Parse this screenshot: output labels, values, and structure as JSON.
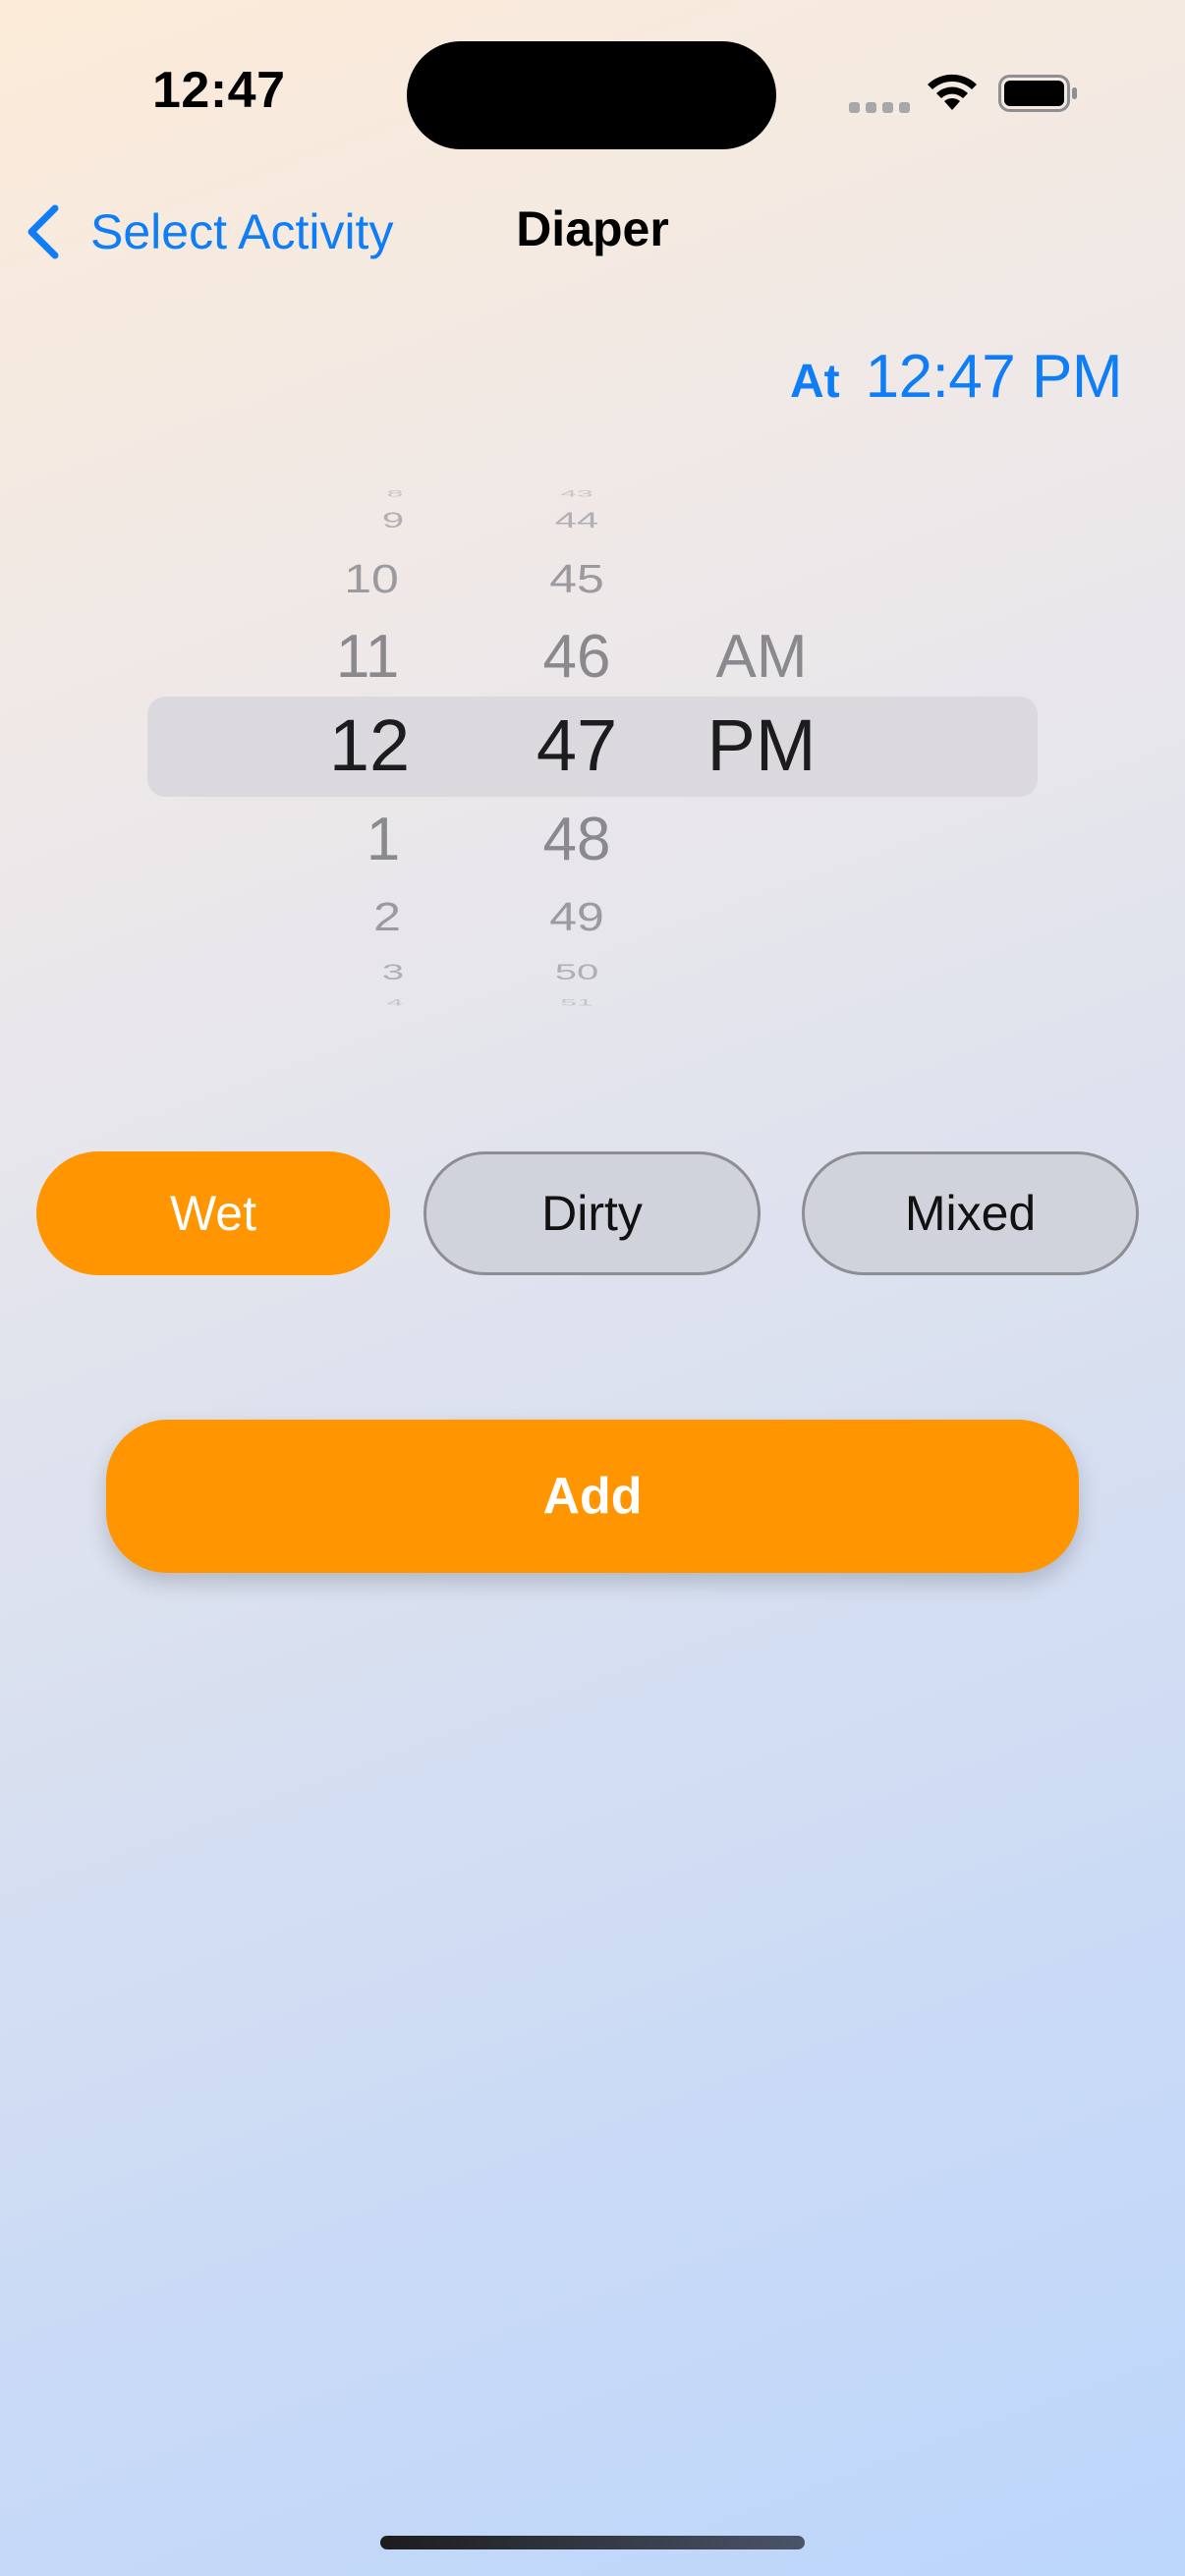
{
  "status_bar": {
    "time": "12:47"
  },
  "nav": {
    "back_label": "Select Activity",
    "title": "Diaper"
  },
  "time_display": {
    "at_label": "At",
    "value": "12:47 PM"
  },
  "picker": {
    "hours": {
      "above": [
        "8",
        "9",
        "10",
        "11"
      ],
      "selected": "12",
      "below": [
        "1",
        "2",
        "3",
        "4"
      ]
    },
    "minutes": {
      "above": [
        "43",
        "44",
        "45",
        "46"
      ],
      "selected": "47",
      "below": [
        "48",
        "49",
        "50",
        "51"
      ]
    },
    "period": {
      "above": [
        "AM"
      ],
      "selected": "PM",
      "below": []
    }
  },
  "diaper_types": {
    "options": [
      "Wet",
      "Dirty",
      "Mixed"
    ],
    "selected": "Wet"
  },
  "add_button": {
    "label": "Add"
  },
  "colors": {
    "accent": "#ff9500",
    "link": "#0f7ef6"
  }
}
